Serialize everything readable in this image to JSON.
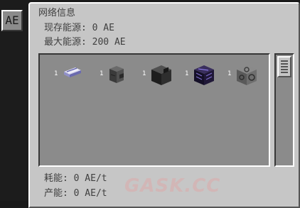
{
  "side_tab": {
    "label": "AE"
  },
  "panel": {
    "title": "网络信息",
    "stored_power": "现存能源: 0 AE",
    "max_power": "最大能源: 200 AE",
    "power_usage": "耗能: 0 AE/t",
    "power_generation": "产能: 0 AE/t"
  },
  "grid": {
    "slots": [
      {
        "count": "1",
        "icon": "glass-cable-icon"
      },
      {
        "count": "1",
        "icon": "interface-icon"
      },
      {
        "count": "1",
        "icon": "storage-block-icon"
      },
      {
        "count": "1",
        "icon": "drive-icon"
      },
      {
        "count": "1",
        "icon": "crafting-unit-icon"
      }
    ]
  },
  "watermark": {
    "text": "GASK.CC"
  },
  "colors": {
    "panel_bg": "#c6c6c6",
    "slot_bg": "#8b8b8b",
    "text": "#404040"
  }
}
